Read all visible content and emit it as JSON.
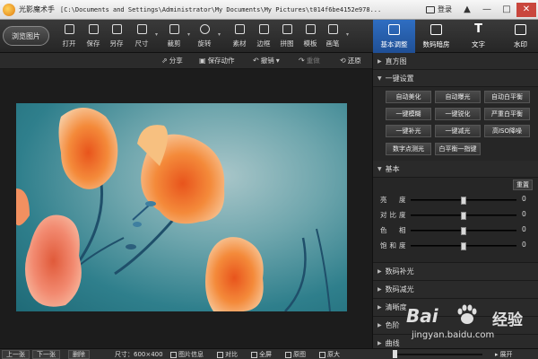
{
  "titlebar": {
    "app_name": "光影魔术手",
    "path": "[C:\\Documents and Settings\\Administrator\\My Documents\\My Pictures\\t014f6be4152e978...",
    "login_label": "登录",
    "window_buttons": [
      "▲",
      "—",
      "□",
      "✕"
    ]
  },
  "toolbar": {
    "browse_label": "浏览图片",
    "tools": [
      {
        "label": "打开",
        "icon": "folder-icon"
      },
      {
        "label": "保存",
        "icon": "save-icon"
      },
      {
        "label": "另存",
        "icon": "save-as-icon"
      },
      {
        "label": "尺寸",
        "icon": "resize-icon"
      },
      {
        "label": "裁剪",
        "icon": "crop-icon"
      },
      {
        "label": "旋转",
        "icon": "rotate-icon"
      },
      {
        "label": "素材",
        "icon": "material-icon"
      },
      {
        "label": "边框",
        "icon": "border-icon"
      },
      {
        "label": "拼图",
        "icon": "collage-icon"
      },
      {
        "label": "模板",
        "icon": "template-icon"
      },
      {
        "label": "画笔",
        "icon": "brush-icon"
      }
    ],
    "right_tabs": [
      {
        "label": "基本调整",
        "icon": "adjust-icon",
        "active": true
      },
      {
        "label": "数码暗房",
        "icon": "camera-icon",
        "active": false
      },
      {
        "label": "文字",
        "icon": "text-icon",
        "active": false
      },
      {
        "label": "水印",
        "icon": "watermark-icon",
        "active": false
      }
    ]
  },
  "actionbar": {
    "share": "分享",
    "save_action": "保存动作",
    "undo": "撤销",
    "redo": "重做",
    "restore": "还原"
  },
  "panel": {
    "histogram": "直方图",
    "onekey": "一键设置",
    "onekey_buttons": [
      "自动美化",
      "自动曝光",
      "自动白平衡",
      "一键模糊",
      "一键锐化",
      "严重白平衡",
      "一键补光",
      "一键减光",
      "高ISO降噪"
    ],
    "onekey_buttons2": [
      "数字点测光",
      "白平衡一指键"
    ],
    "basic": "基本",
    "reset": "重置",
    "sliders": [
      {
        "label": "亮　度",
        "value": 0,
        "position": 0.5
      },
      {
        "label": "对比度",
        "value": 0,
        "position": 0.5
      },
      {
        "label": "色　相",
        "value": 0,
        "position": 0.5
      },
      {
        "label": "饱和度",
        "value": 0,
        "position": 0.5
      }
    ],
    "collapsed_sections": [
      "数码补光",
      "数码减光",
      "清晰度",
      "色阶",
      "曲线"
    ]
  },
  "watermark": {
    "brand": "Bai",
    "brand2": "经验",
    "url": "jingyan.baidu.com"
  },
  "statusbar": {
    "prev": "上一张",
    "next": "下一张",
    "delete": "删除",
    "size": "尺寸：600×400",
    "info": "图片信息",
    "compare": "对比",
    "fullscreen": "全屏",
    "original": "原图",
    "fit": "原大",
    "expand": "展开"
  },
  "colors": {
    "accent": "#2f6ec2",
    "close": "#c9463d"
  }
}
